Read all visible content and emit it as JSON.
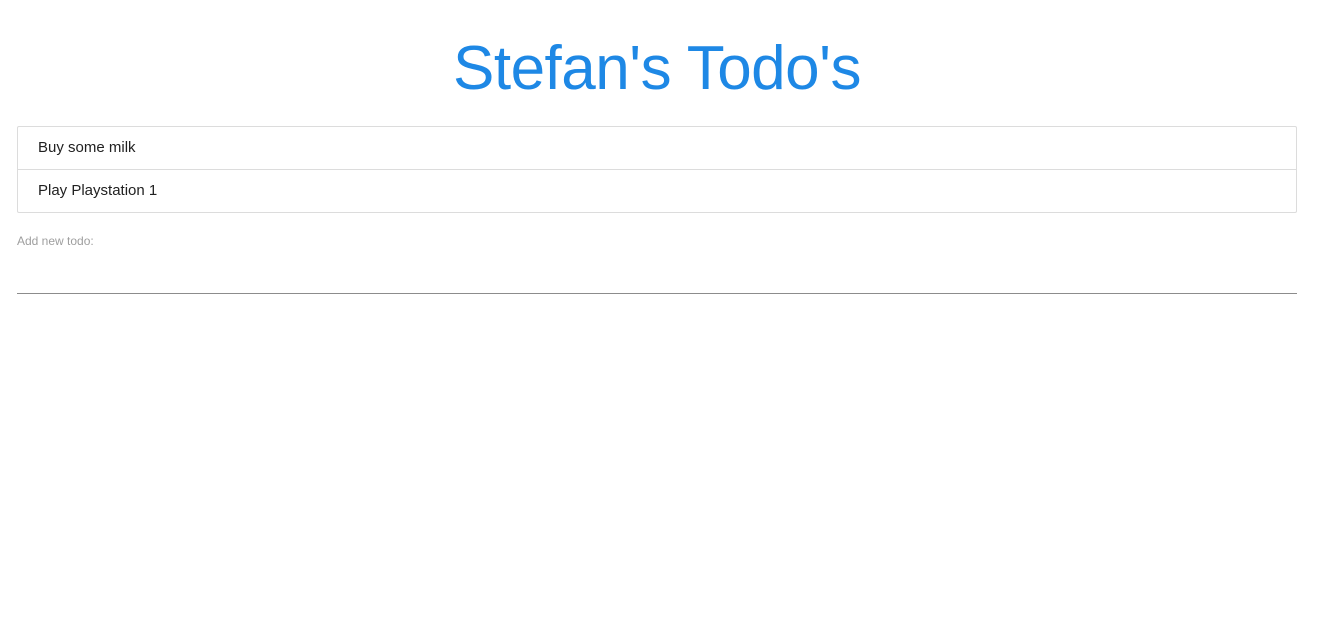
{
  "header": {
    "title": "Stefan's Todo's"
  },
  "todos": {
    "items": [
      {
        "label": "Buy some milk"
      },
      {
        "label": "Play Playstation 1"
      }
    ]
  },
  "add_todo": {
    "label": "Add new todo:",
    "value": "",
    "placeholder": ""
  },
  "colors": {
    "accent": "#1e88e5",
    "text": "#212121",
    "muted": "#9e9e9e",
    "border": "#dcdcdc"
  }
}
